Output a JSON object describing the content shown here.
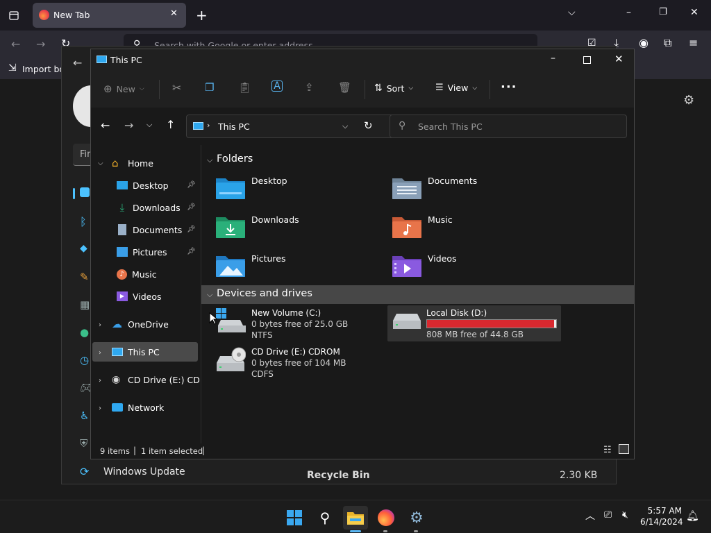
{
  "firefox": {
    "tab_title": "New Tab",
    "search_placeholder": "Search with Google or enter address",
    "bookmark_label": "Import bookmarks..."
  },
  "settings_window": {
    "sidebar_search_partial": "Fin",
    "footer_item": "Windows Update",
    "recycle_bin_name": "Recycle Bin",
    "recycle_bin_size": "2.30 KB"
  },
  "explorer": {
    "title": "This PC",
    "toolbar": {
      "new_label": "New",
      "sort_label": "Sort",
      "view_label": "View",
      "more_label": "···"
    },
    "address": {
      "crumb": "This PC",
      "search_placeholder": "Search This PC"
    },
    "nav": {
      "home": "Home",
      "quick_access": [
        {
          "label": "Desktop",
          "pinned": true
        },
        {
          "label": "Downloads",
          "pinned": true
        },
        {
          "label": "Documents",
          "pinned": true
        },
        {
          "label": "Pictures",
          "pinned": true
        },
        {
          "label": "Music",
          "pinned": false
        },
        {
          "label": "Videos",
          "pinned": false
        }
      ],
      "onedrive": "OneDrive",
      "this_pc": "This PC",
      "cd_drive": "CD Drive (E:) CDROM",
      "network": "Network"
    },
    "folders_header": "Folders",
    "folders": [
      {
        "name": "Desktop",
        "color": "#2aa3e8"
      },
      {
        "name": "Documents",
        "color": "#8aa0b8"
      },
      {
        "name": "Downloads",
        "color": "#2ab07a"
      },
      {
        "name": "Music",
        "color": "#e8744a"
      },
      {
        "name": "Pictures",
        "color": "#3a9ee8"
      },
      {
        "name": "Videos",
        "color": "#8a5ae0"
      }
    ],
    "devices_header": "Devices and drives",
    "drives": {
      "c": {
        "name": "New Volume (C:)",
        "free": "0 bytes free of 25.0 GB",
        "fs": "NTFS"
      },
      "d": {
        "name": "Local Disk (D:)",
        "free": "808 MB free of 44.8 GB",
        "used_fraction": 0.982,
        "bar_color": "#d8282f"
      },
      "e": {
        "name": "CD Drive (E:) CDROM",
        "free": "0 bytes free of 104 MB",
        "fs": "CDFS"
      }
    },
    "status": {
      "items": "9 items",
      "selected": "1 item selected"
    }
  },
  "taskbar": {
    "time": "5:57 AM",
    "date": "6/14/2024"
  }
}
